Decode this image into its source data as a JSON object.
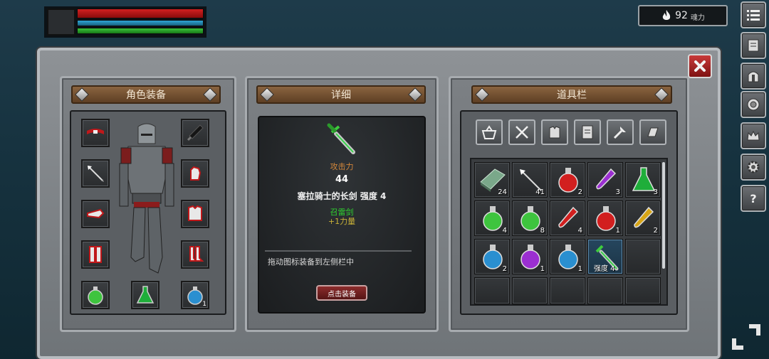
{
  "hud": {
    "health_fill": 1.0,
    "mana_fill": 1.0,
    "stamina_fill": 1.0
  },
  "souls": {
    "value": "92",
    "unit": "魂力"
  },
  "right_rail": [
    "menu-list-icon",
    "inventory-scroll-icon",
    "helmet-icon",
    "disc-icon",
    "crown-icon",
    "settings-gear-icon",
    "help-icon"
  ],
  "panels": {
    "equipment": {
      "title": "角色装备"
    },
    "detail": {
      "title": "详细"
    },
    "items": {
      "title": "道具栏"
    }
  },
  "equipment_slots": [
    {
      "name": "belt",
      "icon": "belt-icon"
    },
    {
      "name": "weapon",
      "icon": "sword-icon"
    },
    {
      "name": "arrow",
      "icon": "arrow-icon"
    },
    {
      "name": "gloves",
      "icon": "gauntlet-icon"
    },
    {
      "name": "bracer",
      "icon": "bracer-icon"
    },
    {
      "name": "chest",
      "icon": "chest-armor-icon"
    },
    {
      "name": "legs",
      "icon": "leg-armor-icon"
    },
    {
      "name": "boots",
      "icon": "boots-icon"
    },
    {
      "name": "quick-1",
      "icon": "green-potion-icon"
    },
    {
      "name": "quick-2",
      "icon": "green-flask-icon"
    },
    {
      "name": "quick-3",
      "icon": "blue-potion-icon",
      "count": "1"
    }
  ],
  "detail": {
    "attack_label": "攻击力",
    "attack_value": "44",
    "item_name": "塞拉骑士的长剑 强度 4",
    "enchant": "召雷剑",
    "bonus": "+1力量",
    "hint": "拖动图标装备到左侧栏中",
    "equip_button": "点击装备"
  },
  "filters": [
    "basket-icon",
    "weapon-filter-icon",
    "armor-filter-icon",
    "scroll-filter-icon",
    "tools-filter-icon",
    "misc-filter-icon"
  ],
  "inventory": [
    {
      "icon": "ore-bar-icon",
      "count": "24"
    },
    {
      "icon": "arrow-icon",
      "count": "41"
    },
    {
      "icon": "red-potion-icon",
      "count": "2"
    },
    {
      "icon": "purple-vial-icon",
      "count": "3"
    },
    {
      "icon": "green-flask-icon",
      "count": "3"
    },
    {
      "icon": "green-potion-icon",
      "count": "4"
    },
    {
      "icon": "green-potion-icon",
      "count": "8"
    },
    {
      "icon": "red-vial-icon",
      "count": "4"
    },
    {
      "icon": "red-potion-icon",
      "count": "1"
    },
    {
      "icon": "yellow-vial-icon",
      "count": "2"
    },
    {
      "icon": "blue-potion-icon",
      "count": "2"
    },
    {
      "icon": "purple-potion-icon",
      "count": "1"
    },
    {
      "icon": "blue-potion-icon",
      "count": "1"
    },
    {
      "icon": "green-sword-icon",
      "count": "",
      "strength": "强度 4",
      "selected": true
    },
    {
      "icon": "",
      "count": ""
    },
    {
      "icon": "",
      "count": ""
    },
    {
      "icon": "",
      "count": ""
    },
    {
      "icon": "",
      "count": ""
    },
    {
      "icon": "",
      "count": ""
    },
    {
      "icon": "",
      "count": ""
    }
  ]
}
